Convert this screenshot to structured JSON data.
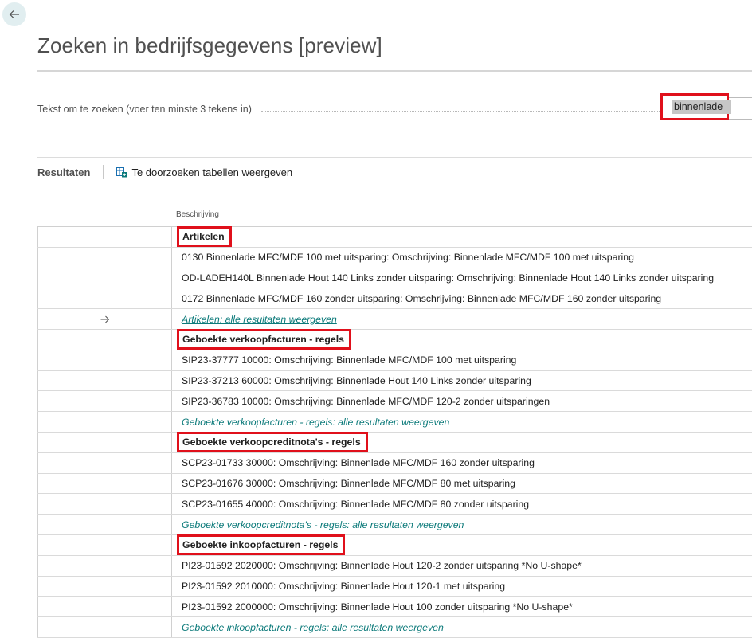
{
  "header": {
    "title": "Zoeken in bedrijfsgegevens [preview]"
  },
  "search": {
    "label": "Tekst om te zoeken (voer ten minste 3 tekens in)",
    "value": "binnenlade"
  },
  "tabs": {
    "results_label": "Resultaten",
    "show_tables_label": "Te doorzoeken tabellen weergeven"
  },
  "grid": {
    "column_header": "Beschrijving",
    "groups": [
      {
        "title": "Artikelen",
        "items": [
          "0130 Binnenlade MFC/MDF 100 met uitsparing: Omschrijving: Binnenlade MFC/MDF 100 met uitsparing",
          "OD-LADEH140L Binnenlade Hout 140 Links zonder uitsparing: Omschrijving: Binnenlade Hout 140 Links zonder uitsparing",
          "0172 Binnenlade MFC/MDF 160 zonder uitsparing: Omschrijving: Binnenlade MFC/MDF 160 zonder uitsparing"
        ],
        "link": "Artikelen: alle resultaten weergeven"
      },
      {
        "title": "Geboekte verkoopfacturen - regels",
        "items": [
          "SIP23-37777 10000: Omschrijving: Binnenlade MFC/MDF 100 met uitsparing",
          "SIP23-37213 60000: Omschrijving: Binnenlade Hout 140 Links zonder uitsparing",
          "SIP23-36783 10000: Omschrijving: Binnenlade MFC/MDF 120-2 zonder uitsparingen"
        ],
        "link": "Geboekte verkoopfacturen - regels: alle resultaten weergeven"
      },
      {
        "title": "Geboekte verkoopcreditnota's - regels",
        "items": [
          "SCP23-01733 30000: Omschrijving: Binnenlade MFC/MDF 160 zonder uitsparing",
          "SCP23-01676 30000: Omschrijving: Binnenlade MFC/MDF 80 met uitsparing",
          "SCP23-01655 40000: Omschrijving: Binnenlade MFC/MDF 80 zonder uitsparing"
        ],
        "link": "Geboekte verkoopcreditnota's - regels: alle resultaten weergeven"
      },
      {
        "title": "Geboekte inkoopfacturen - regels",
        "items": [
          "PI23-01592 2020000: Omschrijving: Binnenlade Hout 120-2 zonder uitsparing *No U-shape*",
          "PI23-01592 2010000: Omschrijving: Binnenlade Hout 120-1 met uitsparing",
          "PI23-01592 2000000: Omschrijving: Binnenlade Hout 100 zonder uitsparing *No U-shape*"
        ],
        "link": "Geboekte inkoopfacturen - regels: alle resultaten weergeven"
      }
    ]
  },
  "icons": {
    "back": "back-arrow-icon",
    "row_pointer": "arrow-right-icon",
    "tables": "table-view-icon"
  },
  "colors": {
    "accent_teal": "#0c7a7a",
    "highlight_red": "#e0101b",
    "back_button_bg": "#e1eef0"
  }
}
